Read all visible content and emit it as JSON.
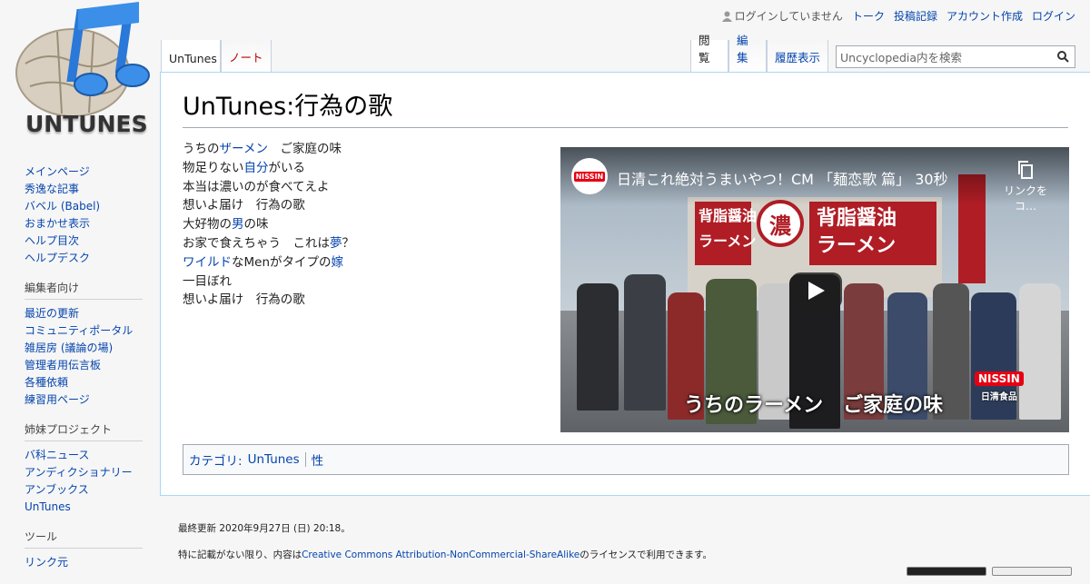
{
  "logo": {
    "text": "UNTUNES"
  },
  "personal": {
    "not_logged_in": "ログインしていません",
    "talk": "トーク",
    "contributions": "投稿記録",
    "create_account": "アカウント作成",
    "login": "ログイン"
  },
  "tabs": {
    "page": "UnTunes",
    "talk": "ノート",
    "read": "閲覧",
    "edit": "編集",
    "history": "履歴表示"
  },
  "search": {
    "placeholder": "Uncyclopedia内を検索"
  },
  "page": {
    "title": "UnTunes:行為の歌",
    "lyrics": {
      "l1": {
        "a": "うちの",
        "link": "ザーメン",
        "b": "　ご家庭の味"
      },
      "l2": {
        "a": "物足りない",
        "link": "自分",
        "b": "がいる"
      },
      "l3": "本当は濃いのが食べてえよ",
      "l4": "想いよ届け　行為の歌",
      "l5": {
        "a": "大好物の",
        "link": "男",
        "b": "の味"
      },
      "l6": {
        "a": "お家で食えちゃう　これは",
        "link": "夢",
        "b": "？"
      },
      "l7": {
        "link": "ワイルド",
        "a": "なMenがタイプの",
        "link2": "嫁"
      },
      "l8": "一目ぼれ",
      "l9": "想いよ届け　行為の歌"
    }
  },
  "video": {
    "channel_badge": "NISSIN",
    "title": "日清これ絶対うまいやつ！CM 「麺恋歌 篇」 30秒",
    "copy_label": "リンクをコ…",
    "sign1": "背脂醤油",
    "sign1b": "ラーメン",
    "sign2": "背脂醤油",
    "sign2b": "ラーメン",
    "sign_circle": "濃",
    "caption": "うちのラーメン　ご家庭の味",
    "brand1": "NISSIN",
    "brand2": "日清食品"
  },
  "categories": {
    "label": "カテゴリ:",
    "items": [
      "UnTunes",
      "性"
    ]
  },
  "sidebar": {
    "nav": [
      "メインページ",
      "秀逸な記事",
      "バベル (Babel)",
      "おまかせ表示",
      "ヘルプ目次",
      "ヘルプデスク"
    ],
    "editors_heading": "編集者向け",
    "editors": [
      "最近の更新",
      "コミュニティポータル",
      "雑居房 (議論の場)",
      "管理者用伝言板",
      "各種依頼",
      "練習用ページ"
    ],
    "sister_heading": "姉妹プロジェクト",
    "sister": [
      "バ科ニュース",
      "アンディクショナリー",
      "アンブックス",
      "UnTunes"
    ],
    "tools_heading": "ツール",
    "tools": [
      "リンク元"
    ]
  },
  "footer": {
    "last_modified": "最終更新 2020年9月27日 (日) 20:18。",
    "license_pre": "特に記載がない限り、内容は",
    "license_link": "Creative Commons Attribution-NonCommercial-ShareAlike",
    "license_post": "のライセンスで利用できます。"
  },
  "colors": {
    "link": "#0645ad",
    "new_link": "#ba0000",
    "border": "#a7d7f9"
  }
}
